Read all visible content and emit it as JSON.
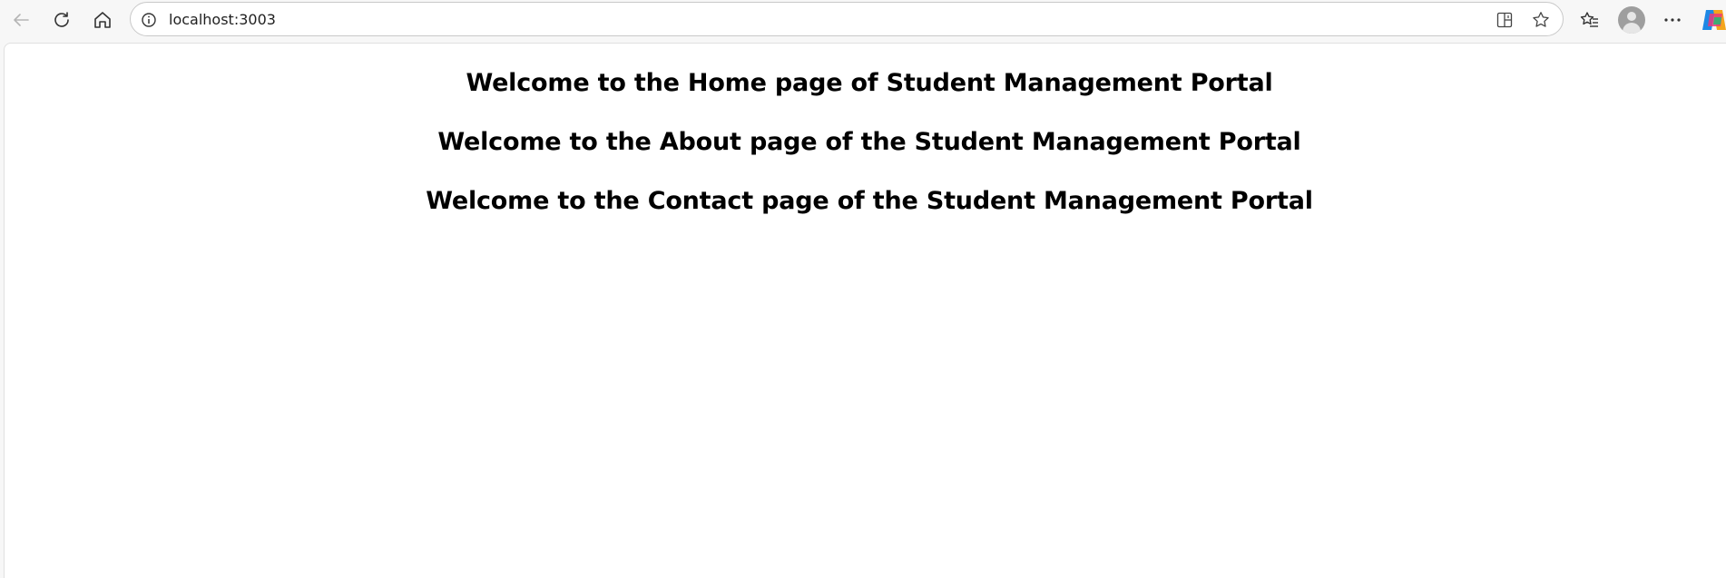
{
  "browser": {
    "url": "localhost:3003",
    "icons": {
      "back": "back-arrow-icon",
      "refresh": "refresh-icon",
      "home": "home-icon",
      "site_info": "info-icon",
      "split_screen": "split-screen-icon",
      "favorite": "star-icon",
      "favorites_list": "favorites-icon",
      "profile": "profile-avatar",
      "menu": "more-icon",
      "copilot": "copilot-icon"
    }
  },
  "page": {
    "headings": [
      "Welcome to the Home page of Student Management Portal",
      "Welcome to the About page of the Student Management Portal",
      "Welcome to the Contact page of the Student Management Portal"
    ]
  }
}
